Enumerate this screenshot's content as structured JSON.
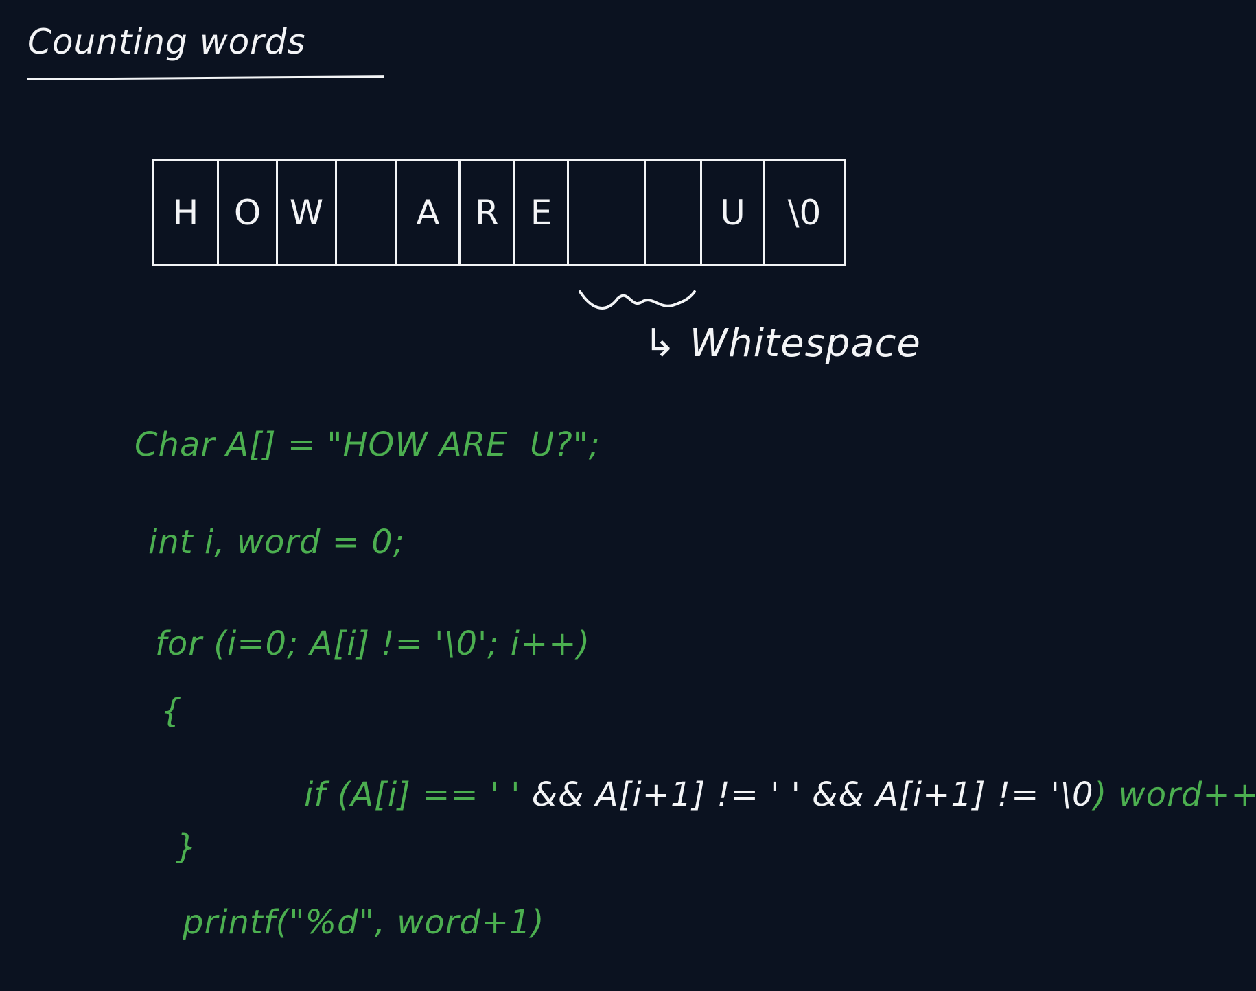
{
  "title": "Counting words",
  "array": {
    "cells": [
      "H",
      "O",
      "W",
      "",
      "A",
      "R",
      "E",
      "",
      "",
      "U",
      "\\0"
    ]
  },
  "annotation": {
    "label": "↳ Whitespace"
  },
  "code": {
    "line1": "Char A[] = \"HOW ARE  U?\";",
    "line2": "int i, word = 0;",
    "line3": "for (i=0; A[i] != '\\0'; i++)",
    "line4": "{",
    "line5_start": "if (A[i] == ' '",
    "line5_middle": " && A[i+1] != ' ' && A[i+1] != '\\0",
    "line5_end": ") word++;",
    "line6": "}",
    "line7": "printf(\"%d\", word+1)"
  },
  "colors": {
    "background": "#0b1220",
    "ink_white": "#f3f4f6",
    "ink_green": "#4caf50"
  }
}
